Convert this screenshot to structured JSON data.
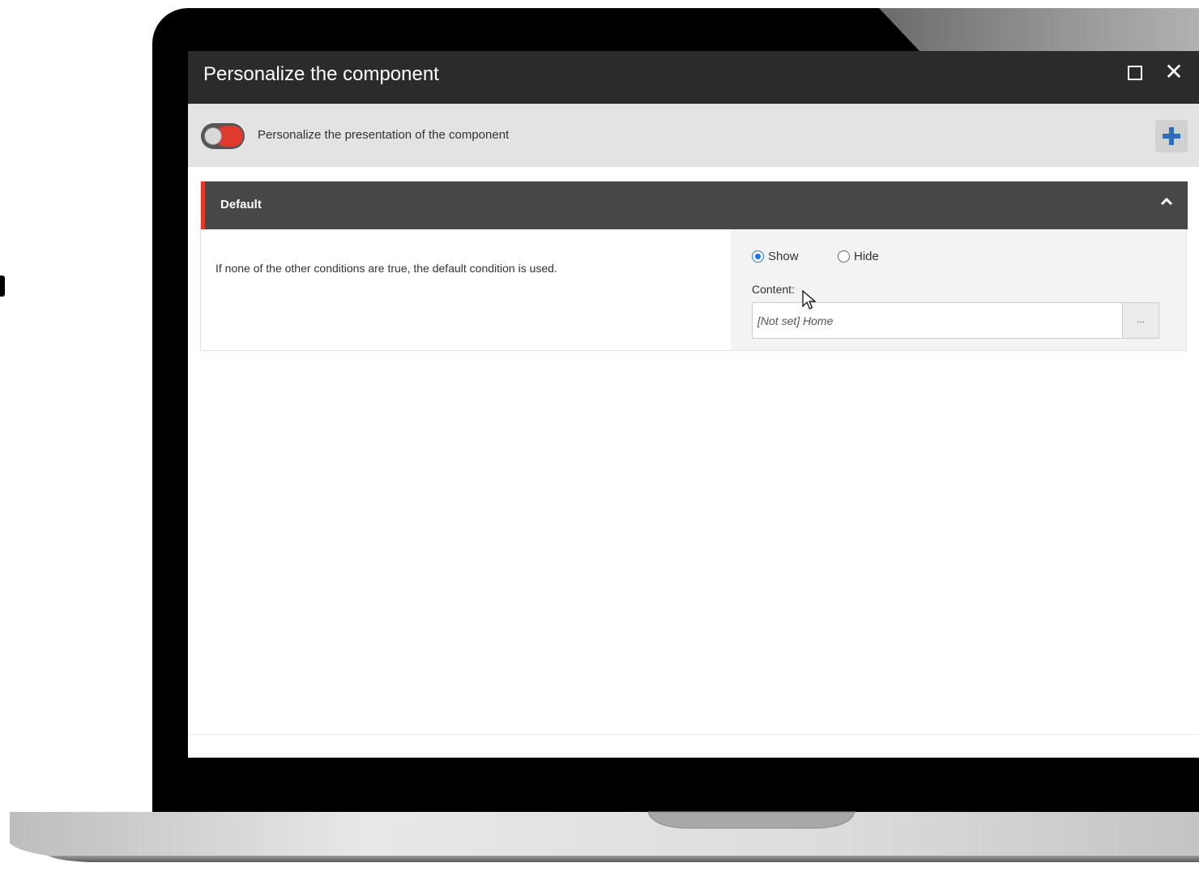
{
  "dialog": {
    "title": "Personalize the component",
    "maximize_icon": "maximize-icon",
    "close_icon": "close-icon"
  },
  "toolbar": {
    "toggle_on": false,
    "label": "Personalize the presentation of the component",
    "add_icon": "plus-icon"
  },
  "section": {
    "title": "Default",
    "expanded": true,
    "description": "If none of the other conditions are true, the default condition is used.",
    "visibility": {
      "options": [
        "Show",
        "Hide"
      ],
      "selected": "Show"
    },
    "content": {
      "label": "Content:",
      "value": "[Not set] Home",
      "browse_label": "..."
    }
  },
  "colors": {
    "accent": "#e03a2c",
    "titlebar": "#2b2b2b",
    "section_header": "#474747",
    "radio_selected": "#1a73e8",
    "add_icon": "#2d6ebf"
  }
}
